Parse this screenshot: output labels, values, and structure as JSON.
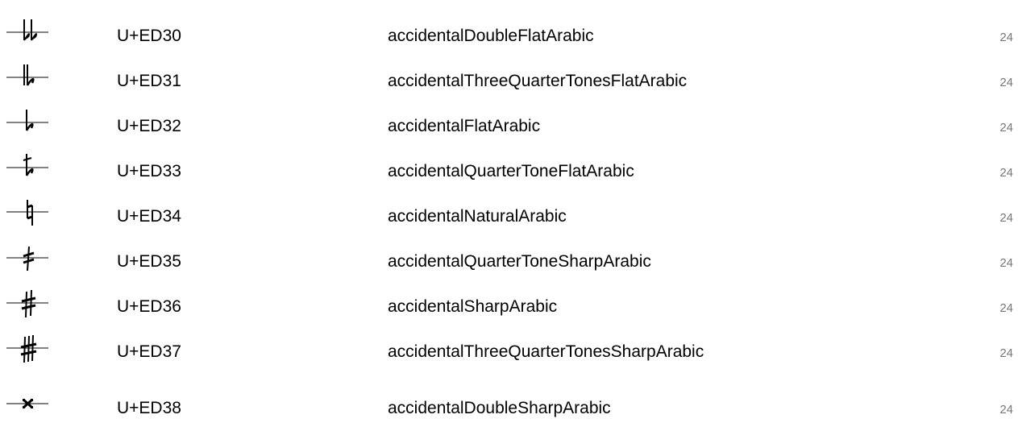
{
  "glyphs": [
    {
      "symbol": "accidental-double-flat-arabic-icon",
      "codepoint": "U+ED30",
      "name": "accidentalDoubleFlatArabic",
      "version": "24"
    },
    {
      "symbol": "accidental-three-quarter-tones-flat-arabic-icon",
      "codepoint": "U+ED31",
      "name": "accidentalThreeQuarterTonesFlatArabic",
      "version": "24"
    },
    {
      "symbol": "accidental-flat-arabic-icon",
      "codepoint": "U+ED32",
      "name": "accidentalFlatArabic",
      "version": "24"
    },
    {
      "symbol": "accidental-quarter-tone-flat-arabic-icon",
      "codepoint": "U+ED33",
      "name": "accidentalQuarterToneFlatArabic",
      "version": "24"
    },
    {
      "symbol": "accidental-natural-arabic-icon",
      "codepoint": "U+ED34",
      "name": "accidentalNaturalArabic",
      "version": "24"
    },
    {
      "symbol": "accidental-quarter-tone-sharp-arabic-icon",
      "codepoint": "U+ED35",
      "name": "accidentalQuarterToneSharpArabic",
      "version": "24"
    },
    {
      "symbol": "accidental-sharp-arabic-icon",
      "codepoint": "U+ED36",
      "name": "accidentalSharpArabic",
      "version": "24"
    },
    {
      "symbol": "accidental-three-quarter-tones-sharp-arabic-icon",
      "codepoint": "U+ED37",
      "name": "accidentalThreeQuarterTonesSharpArabic",
      "version": "24"
    },
    {
      "symbol": "accidental-double-sharp-arabic-icon",
      "codepoint": "U+ED38",
      "name": "accidentalDoubleSharpArabic",
      "version": "24"
    }
  ]
}
